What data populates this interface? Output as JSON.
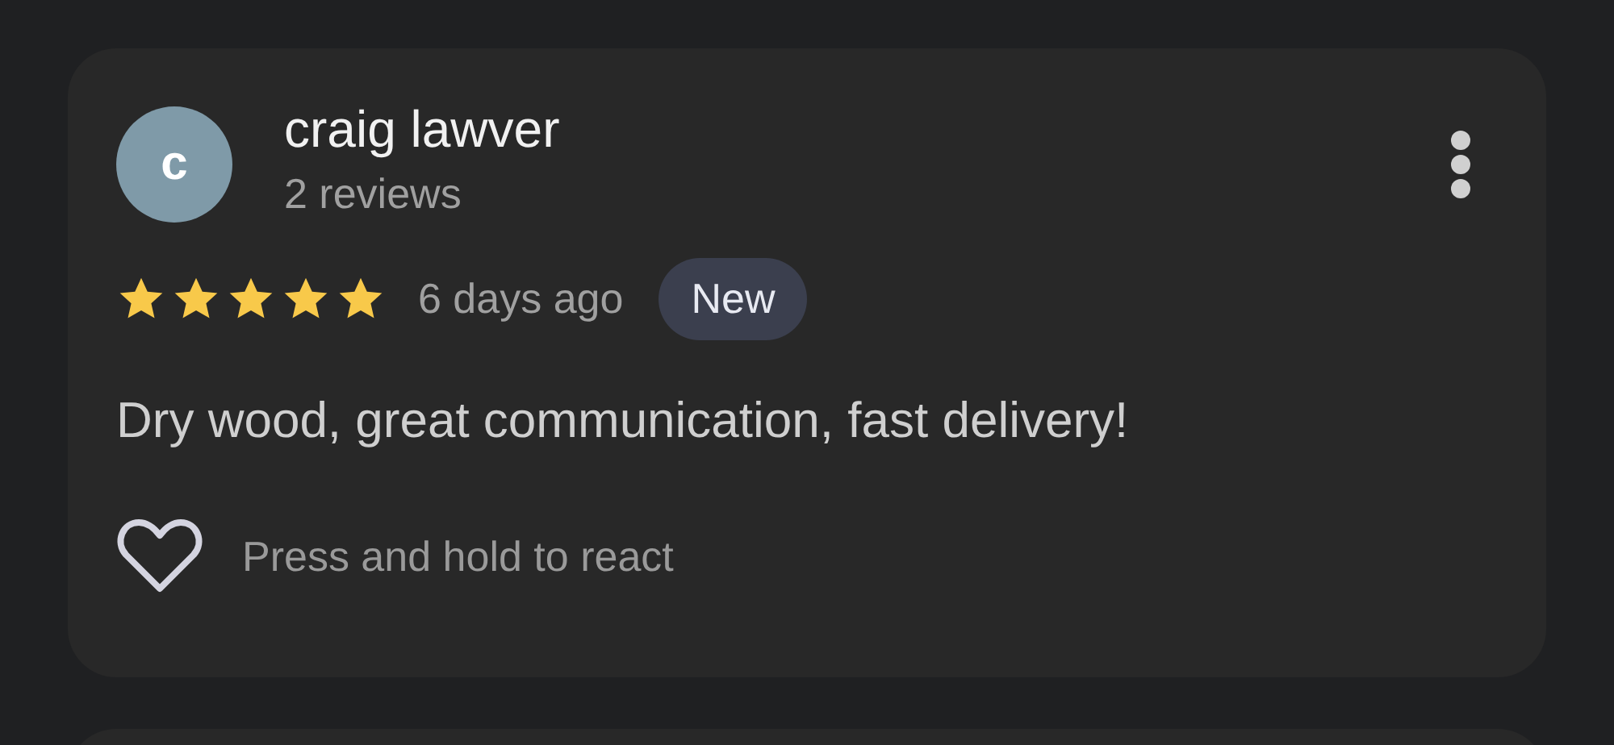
{
  "review": {
    "avatar_letter": "c",
    "author": "craig lawver",
    "author_meta": "2 reviews",
    "stars": 5,
    "time": "6 days ago",
    "badge": "New",
    "text": "Dry wood, great communication, fast delivery!",
    "reaction_hint": "Press and hold to react"
  }
}
